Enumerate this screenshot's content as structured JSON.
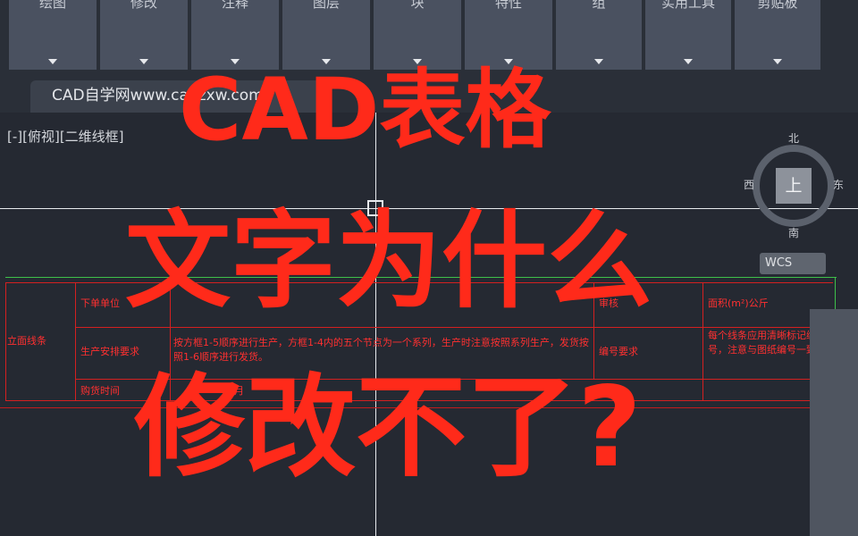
{
  "ribbon": {
    "panels": [
      {
        "label": "绘图"
      },
      {
        "label": "修改"
      },
      {
        "label": "注释"
      },
      {
        "label": "图层"
      },
      {
        "label": "块"
      },
      {
        "label": "特性"
      },
      {
        "label": "组"
      },
      {
        "label": "实用工具"
      },
      {
        "label": "剪贴板"
      }
    ]
  },
  "document_tab": {
    "title": "CAD自学网www.cadzxw.com"
  },
  "viewport": {
    "label": "[-][俯视][二维线框]"
  },
  "viewcube": {
    "north": "北",
    "south": "南",
    "east": "东",
    "west": "西",
    "top": "上",
    "coordinate_system": "WCS"
  },
  "table": {
    "row_header": "立面线条",
    "cells": {
      "order_unit": "下单单位",
      "order_unit_value": "",
      "production_req": "生产安排要求",
      "production_req_value": "按方框1-5顺序进行生产，方框1-4内的五个节点为一个系列，生产时注意按照系列生产，发货按照1-6顺序进行发货。",
      "order_time": "购货时间",
      "order_time_value": "月",
      "review": "审核",
      "numbering_req": "编号要求",
      "area": "面积(m²)公斤",
      "numbering_value": "每个线条应用清晰标记编号，注意与图纸编号一致。"
    }
  },
  "overlay": {
    "line1": "CAD表格",
    "line2": "文字为什么",
    "line3": "修改不了?"
  },
  "colors": {
    "overlay_text": "#ff2a1a",
    "table_lines": "#d42020",
    "green_line": "#3ec04a",
    "crosshair": "#e8eaee"
  }
}
